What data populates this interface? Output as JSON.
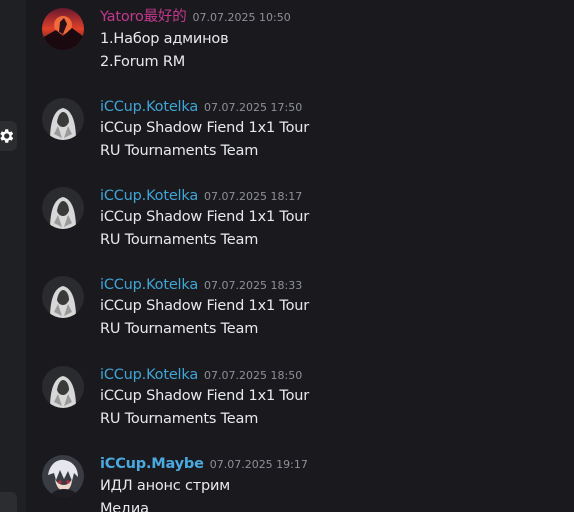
{
  "messages": [
    {
      "author": "Yatoro最好的",
      "timestamp": "07.07.2025 10:50",
      "lines": [
        "1.Набор админов",
        "2.Forum RM"
      ],
      "avatar": "red-sunset-avatar"
    },
    {
      "author": "iCCup.Kotelka",
      "timestamp": "07.07.2025 17:50",
      "lines": [
        "iCCup Shadow Fiend 1x1 Tour",
        "RU Tournaments Team"
      ],
      "avatar": "hooded-figure-avatar"
    },
    {
      "author": "iCCup.Kotelka",
      "timestamp": "07.07.2025 18:17",
      "lines": [
        "iCCup Shadow Fiend 1x1 Tour",
        "RU Tournaments Team"
      ],
      "avatar": "hooded-figure-avatar"
    },
    {
      "author": "iCCup.Kotelka",
      "timestamp": "07.07.2025 18:33",
      "lines": [
        "iCCup Shadow Fiend 1x1 Tour",
        "RU Tournaments Team"
      ],
      "avatar": "hooded-figure-avatar"
    },
    {
      "author": "iCCup.Kotelka",
      "timestamp": "07.07.2025 18:50",
      "lines": [
        "iCCup Shadow Fiend 1x1 Tour",
        "RU Tournaments Team"
      ],
      "avatar": "hooded-figure-avatar"
    },
    {
      "author": "iCCup.Maybe",
      "timestamp": "07.07.2025 19:17",
      "lines": [
        "ИДЛ анонс стрим",
        "Медиа"
      ],
      "avatar": "anime-character-avatar"
    }
  ],
  "colors": {
    "background": "#1a1a1e",
    "rail": "#1f2023",
    "author_yatoro": "#c2398e",
    "author_kotelka": "#3fa4d6",
    "author_maybe": "#4aa9e0",
    "timestamp": "#8e9097",
    "text": "#e8e9ec"
  },
  "rail": {
    "settings_icon": "gear-icon"
  }
}
